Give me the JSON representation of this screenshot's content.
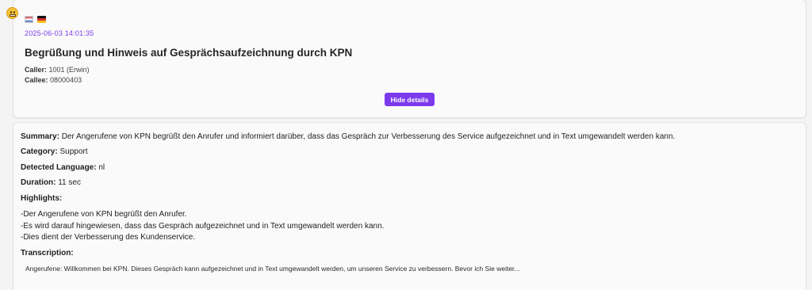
{
  "call": {
    "sentiment_icon": "grimacing-face-icon",
    "language_flags": [
      "flag-nl-icon",
      "flag-de-icon"
    ],
    "timestamp": "2025-06-03 14:01:35",
    "title": "Begrüßung und Hinweis auf Gesprächsaufzeichnung durch KPN",
    "caller_label": "Caller:",
    "caller_value": "1001 (Erwin)",
    "callee_label": "Callee:",
    "callee_value": "08000403",
    "hide_details_label": "Hide details"
  },
  "details": {
    "summary_label": "Summary:",
    "summary_value": "Der Angerufene von KPN begrüßt den Anrufer und informiert darüber, dass das Gespräch zur Verbesserung des Service aufgezeichnet und in Text umgewandelt werden kann.",
    "category_label": "Category:",
    "category_value": "Support",
    "language_label": "Detected Language:",
    "language_value": "nl",
    "duration_label": "Duration:",
    "duration_value": "11 sec",
    "highlights_label": "Highlights:",
    "highlights": [
      "-Der Angerufene von KPN begrüßt den Anrufer.",
      "-Es wird darauf hingewiesen, dass das Gespräch aufgezeichnet und in Text umgewandelt werden kann.",
      "-Dies dient der Verbesserung des Kundenservice."
    ],
    "transcription_label": "Transcription:",
    "transcription_text": "Angerufene: Willkommen bei KPN. Dieses Gespräch kann aufgezeichnet und in Text umgewandelt werden, um unseren Service zu verbessern. Bevor ich Sie weiter..."
  },
  "colors": {
    "accent": "#7c3aed",
    "background": "#f4f4f5",
    "card": "#fafafa"
  }
}
